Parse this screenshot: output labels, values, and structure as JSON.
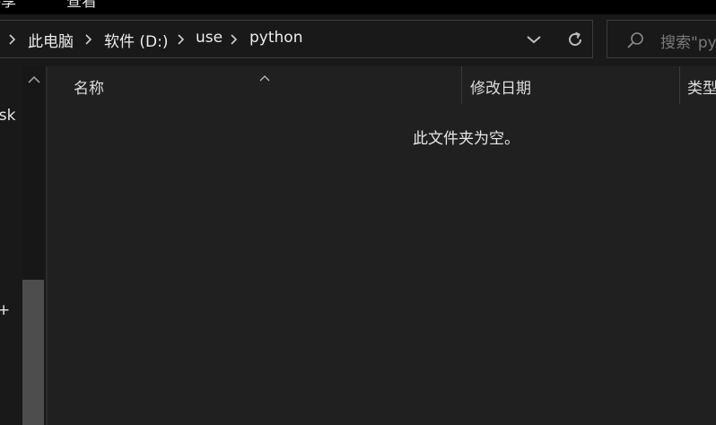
{
  "ribbon": {
    "tabs": [
      {
        "label": "共享"
      },
      {
        "label": "查看"
      }
    ]
  },
  "address_bar": {
    "breadcrumbs": [
      {
        "label": "此电脑"
      },
      {
        "label": "软件 (D:)"
      },
      {
        "label": "use"
      },
      {
        "label": "python"
      }
    ],
    "history_dropdown_icon": "chevron-down-icon",
    "refresh_icon": "refresh-icon"
  },
  "search": {
    "icon": "search-icon",
    "placeholder": "搜索\"python\""
  },
  "nav_pane": {
    "partial_label_1": "isk",
    "partial_label_2": "+",
    "scroll_up_icon": "chevron-up-icon"
  },
  "columns": [
    {
      "label": "名称",
      "sorted": "ascending"
    },
    {
      "label": "修改日期"
    },
    {
      "label": "类型"
    }
  ],
  "content": {
    "empty_message": "此文件夹为空。"
  },
  "colors": {
    "window_background": "#191919",
    "content_background": "#202020",
    "text": "#e6e6e6",
    "border": "#3c3c3c",
    "scrollbar_thumb": "#4d4d4d"
  }
}
